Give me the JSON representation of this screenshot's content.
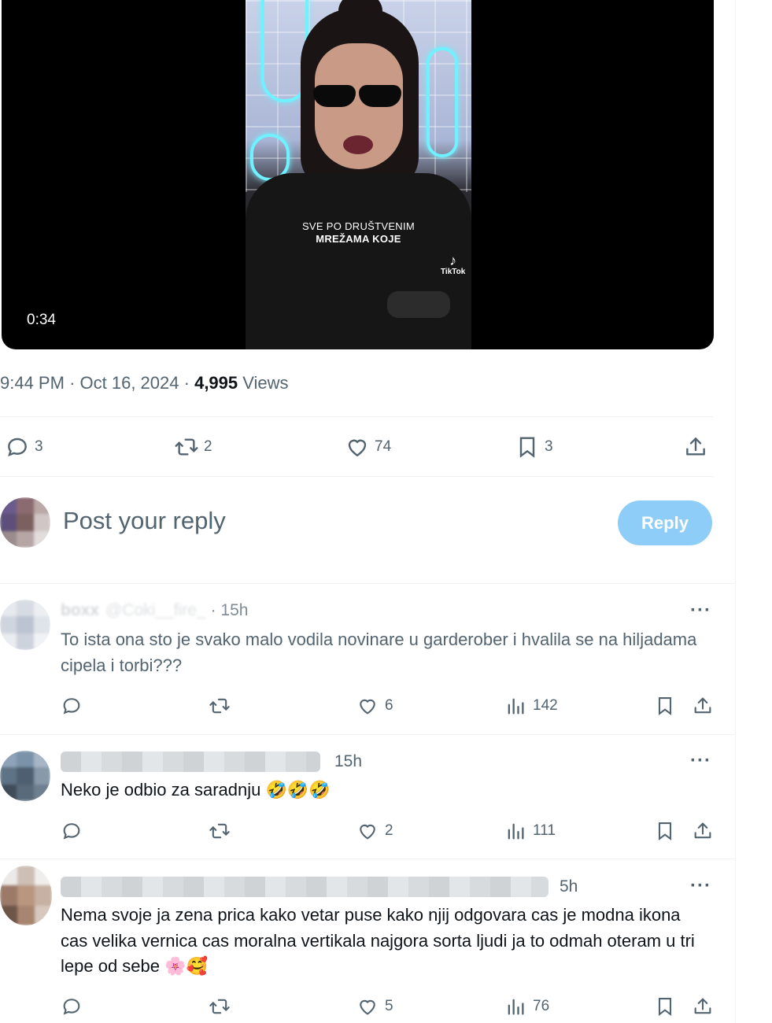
{
  "video": {
    "duration": "0:34",
    "caption_line1": "SVE PO DRUŠTVENIM",
    "caption_line2": "MREŽAMA KOJE",
    "watermark": "TikTok"
  },
  "tweet_meta": {
    "time": "9:44 PM",
    "separator": "·",
    "date": "Oct 16, 2024",
    "views_count": "4,995",
    "views_label": "Views"
  },
  "tweet_actions": {
    "replies": "3",
    "reposts": "2",
    "likes": "74",
    "bookmarks": "3"
  },
  "composer": {
    "placeholder": "Post your reply",
    "reply_label": "Reply"
  },
  "replies": [
    {
      "name": "boxx",
      "handle": "@Coki__fire_",
      "time": "· 15h",
      "text": "To ista ona sto je svako malo vodila novinare u garderober i hvalila se na hiljadama cipela i torbi???",
      "likes": "6",
      "views": "142"
    },
    {
      "time": "15h",
      "text": "Neko je odbio za saradnju",
      "emoji": "🤣🤣🤣",
      "likes": "2",
      "views": "111"
    },
    {
      "time": "5h",
      "text": "Nema svoje ja zena prica kako vetar puse kako njij odgovara cas je modna ikona cas velika vernica cas moralna vertikala najgora sorta ljudi ja to odmah oteram u tri lepe od sebe",
      "emoji": "🌸🥰",
      "likes": "5",
      "views": "76"
    }
  ],
  "colors": {
    "accent_disabled": "#8ecdf8",
    "secondary_text": "#536471",
    "primary_text": "#0f1419",
    "divider": "#eff3f4"
  }
}
